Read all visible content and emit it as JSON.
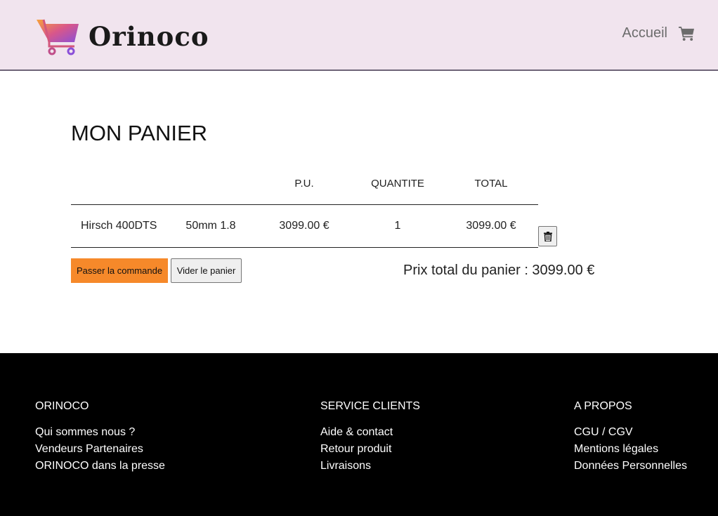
{
  "brand": {
    "name": "Orinoco"
  },
  "nav": {
    "home": "Accueil",
    "cart_icon": "shopping-cart-icon"
  },
  "page": {
    "title": "MON PANIER"
  },
  "table": {
    "headers": {
      "pu": "P.U.",
      "qty": "QUANTITE",
      "total": "TOTAL"
    },
    "rows": [
      {
        "name": "Hirsch 400DTS",
        "lens": "50mm 1.8",
        "pu": "3099.00 €",
        "qty": "1",
        "total": "3099.00 €"
      }
    ]
  },
  "actions": {
    "order": "Passer la commande",
    "empty": "Vider le panier",
    "delete_icon": "trash-icon"
  },
  "total_line": "Prix total du panier : 3099.00 €",
  "footer": {
    "col1": {
      "title": "ORINOCO",
      "links": [
        "Qui sommes nous ?",
        "Vendeurs Partenaires",
        "ORINOCO dans la presse"
      ]
    },
    "col2": {
      "title": "SERVICE CLIENTS",
      "links": [
        "Aide & contact",
        "Retour produit",
        "Livraisons"
      ]
    },
    "col3": {
      "title": "A PROPOS",
      "links": [
        "CGU / CGV",
        "Mentions légales",
        "Données Personnelles"
      ]
    }
  },
  "colors": {
    "header_bg": "#f1e4ee",
    "order_button": "#f6892a",
    "footer_bg": "#000000"
  }
}
